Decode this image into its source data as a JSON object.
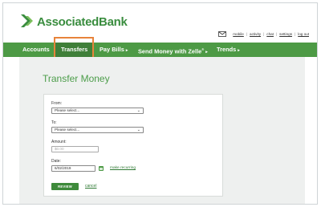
{
  "brand": {
    "name": "AssociatedBank",
    "green": "#4d9a45",
    "highlight": "#e8833a"
  },
  "header": {
    "links": [
      {
        "label": "mobile"
      },
      {
        "label": "activity"
      },
      {
        "label": "chat"
      },
      {
        "label": "settings"
      },
      {
        "label": "log out"
      }
    ]
  },
  "nav": {
    "items": [
      {
        "label": "Accounts"
      },
      {
        "label": "Transfers"
      },
      {
        "label": "Pay Bills"
      },
      {
        "label": "Send Money with Zelle"
      },
      {
        "label": "Trends"
      }
    ],
    "active": "Transfers",
    "zelle_mark": "®",
    "caret": "▸"
  },
  "page": {
    "title": "Transfer Money"
  },
  "form": {
    "from_label": "From:",
    "from_value": "Please select...",
    "to_label": "To:",
    "to_value": "Please select...",
    "amount_label": "Amount:",
    "amount_placeholder": "$0.00",
    "date_label": "Date:",
    "date_value": "6/02/2019",
    "make_recurring": "make recurring",
    "review_label": "REVIEW",
    "cancel_label": "cancel"
  },
  "icons": {
    "logo": "associated-bank-logo-icon",
    "mail": "mail-icon",
    "select_chevron": "chevron-down-icon",
    "calendar": "calendar-icon"
  }
}
